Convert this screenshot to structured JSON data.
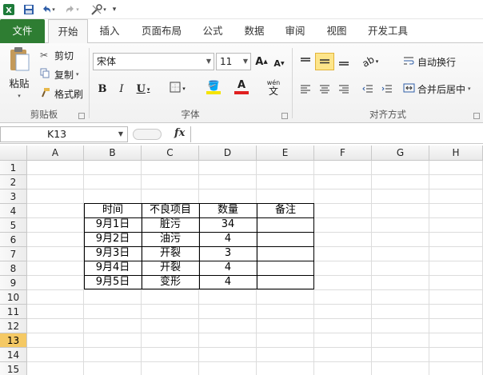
{
  "qat": {
    "excel_icon": "excel-icon",
    "save_icon": "save-icon",
    "undo_icon": "undo-icon",
    "redo_icon": "redo-icon",
    "customize_icon": "tools-icon"
  },
  "tabs": {
    "file": "文件",
    "home": "开始",
    "insert": "插入",
    "page_layout": "页面布局",
    "formulas": "公式",
    "data": "数据",
    "review": "审阅",
    "view": "视图",
    "developer": "开发工具"
  },
  "ribbon": {
    "clipboard": {
      "label": "剪贴板",
      "paste": "粘贴",
      "cut": "剪切",
      "copy": "复制",
      "format_painter": "格式刷"
    },
    "font": {
      "label": "字体",
      "font_name": "宋体",
      "font_size": "11",
      "grow": "A",
      "shrink": "A",
      "bold": "B",
      "italic": "I",
      "underline": "U",
      "phonetic": "wén",
      "phonetic_char": "文"
    },
    "alignment": {
      "label": "对齐方式",
      "wrap_text": "自动换行",
      "merge_center": "合并后居中"
    }
  },
  "formula_bar": {
    "name_box": "K13",
    "fx": "fx",
    "formula": ""
  },
  "grid": {
    "columns": [
      "A",
      "B",
      "C",
      "D",
      "E",
      "F",
      "G",
      "H"
    ],
    "rows": [
      "1",
      "2",
      "3",
      "4",
      "5",
      "6",
      "7",
      "8",
      "9",
      "10",
      "11",
      "12",
      "13",
      "14",
      "15"
    ],
    "selected_cell": "K13",
    "table_header": [
      "时间",
      "不良项目",
      "数量",
      "备注"
    ],
    "table_rows": [
      [
        "9月1日",
        "脏污",
        "34",
        ""
      ],
      [
        "9月2日",
        "油污",
        "4",
        ""
      ],
      [
        "9月3日",
        "开裂",
        "3",
        ""
      ],
      [
        "9月4日",
        "开裂",
        "4",
        ""
      ],
      [
        "9月5日",
        "变形",
        "4",
        ""
      ]
    ]
  },
  "colors": {
    "file_tab": "#2e7d32",
    "selected_row_header": "#f5c964",
    "highlight_button": "#fde58a",
    "font_color_bar": "#e02020",
    "fill_color_bar": "#f5e400"
  }
}
